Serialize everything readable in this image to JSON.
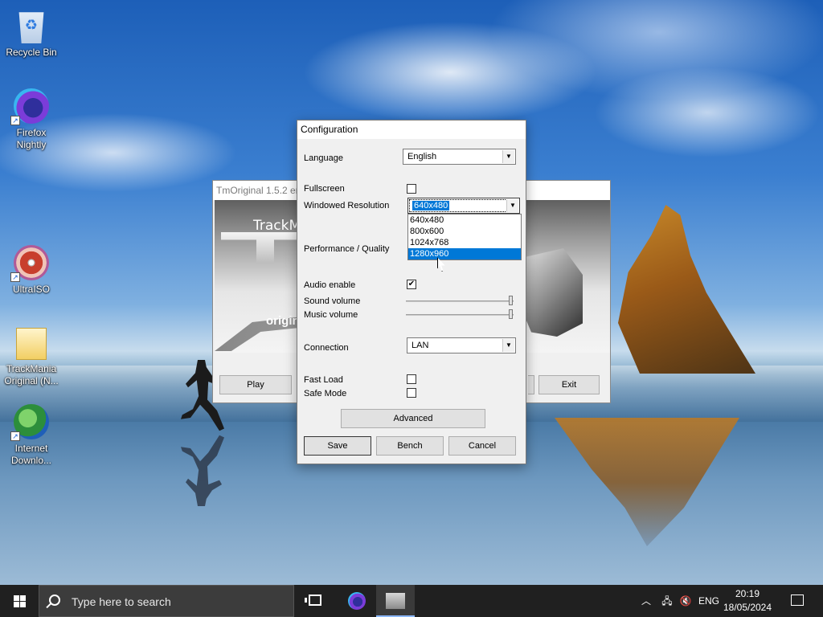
{
  "desktop": {
    "icons": [
      {
        "label": "Recycle Bin",
        "icon": "recycle-bin-icon"
      },
      {
        "label": "Firefox Nightly",
        "icon": "firefox-nightly-icon"
      },
      {
        "label": "UltraISO",
        "icon": "ultraiso-icon"
      },
      {
        "label": "TrackMania Original (N...",
        "icon": "folder-icon"
      },
      {
        "label": "Internet Downlo...",
        "icon": "idm-icon"
      }
    ]
  },
  "launcher": {
    "title": "TmOriginal 1.5.2 en",
    "banner_text": "TrackM",
    "banner_sub": "origin",
    "play_label": "Play",
    "exit_label": "Exit"
  },
  "config": {
    "title": "Configuration",
    "language_label": "Language",
    "language_value": "English",
    "fullscreen_label": "Fullscreen",
    "fullscreen_checked": false,
    "resolution_label": "Windowed Resolution",
    "resolution_value": "640x480",
    "resolution_options": [
      "640x480",
      "800x600",
      "1024x768",
      "1280x960"
    ],
    "resolution_highlighted": "1280x960",
    "performance_label": "Performance / Quality",
    "audio_label": "Audio enable",
    "audio_checked": true,
    "sound_volume_label": "Sound volume",
    "sound_volume_level": 1.0,
    "music_volume_label": "Music volume",
    "music_volume_level": 1.0,
    "connection_label": "Connection",
    "connection_value": "LAN",
    "fast_load_label": "Fast Load",
    "fast_load_checked": false,
    "safe_mode_label": "Safe Mode",
    "safe_mode_checked": false,
    "advanced_label": "Advanced",
    "save_label": "Save",
    "bench_label": "Bench",
    "cancel_label": "Cancel",
    "check_mark": "✔"
  },
  "taskbar": {
    "search_placeholder": "Type here to search",
    "language": "ENG",
    "time": "20:19",
    "date": "18/05/2024",
    "tray_chevron": "︿",
    "accent": "#0078d7"
  }
}
